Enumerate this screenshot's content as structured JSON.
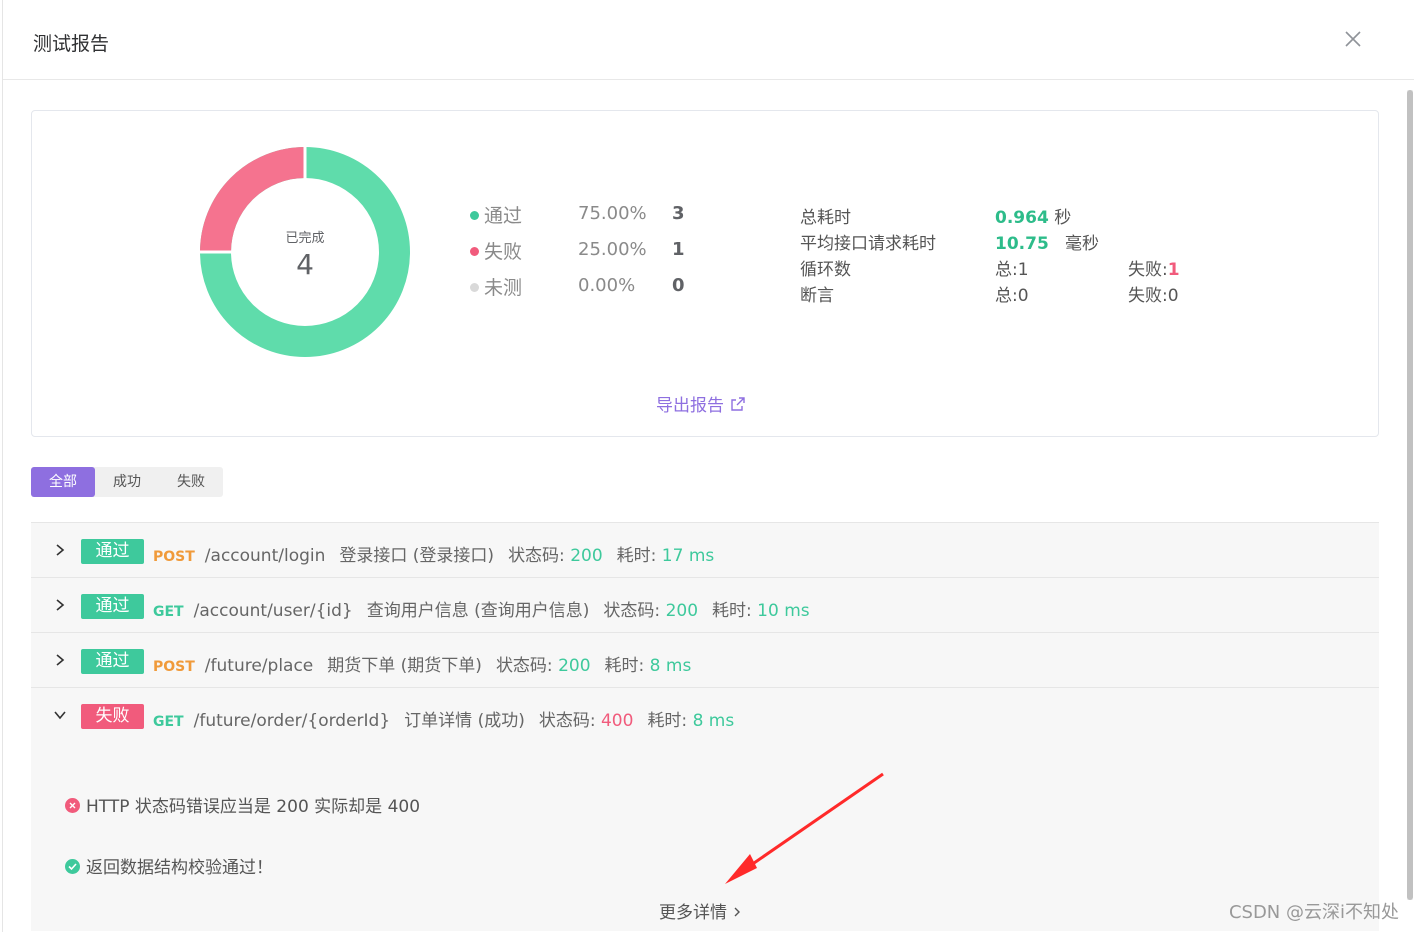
{
  "dialog": {
    "title": "测试报告"
  },
  "summary": {
    "center_label": "已完成",
    "center_value": "4",
    "legend": [
      {
        "name": "通过",
        "pct": "75.00%",
        "count": "3",
        "color": "#5fdcab"
      },
      {
        "name": "失败",
        "pct": "25.00%",
        "count": "1",
        "color": "#f5738f"
      },
      {
        "name": "未测",
        "pct": "0.00%",
        "count": "0",
        "color": "#d9d9d9"
      }
    ],
    "stats": {
      "total_time_label": "总耗时",
      "total_time_value": "0.964",
      "total_time_unit": "秒",
      "avg_time_label": "平均接口请求耗时",
      "avg_time_value": "10.75",
      "avg_time_unit": "毫秒",
      "loop_label": "循环数",
      "loop_total": "总:1",
      "loop_fail_label": "失败:",
      "loop_fail_value": "1",
      "assert_label": "断言",
      "assert_total": "总:0",
      "assert_fail": "失败:0"
    },
    "export_label": "导出报告"
  },
  "filter": {
    "tabs": [
      "全部",
      "成功",
      "失败"
    ],
    "active": 0
  },
  "results": [
    {
      "status": "通过",
      "method": "POST",
      "path": "/account/login",
      "name": "登录接口 (登录接口)",
      "code_label": "状态码:",
      "code": "200",
      "time_label": "耗时:",
      "time": "17 ms"
    },
    {
      "status": "通过",
      "method": "GET",
      "path": "/account/user/{id}",
      "name": "查询用户信息 (查询用户信息)",
      "code_label": "状态码:",
      "code": "200",
      "time_label": "耗时:",
      "time": "10 ms"
    },
    {
      "status": "通过",
      "method": "POST",
      "path": "/future/place",
      "name": "期货下单 (期货下单)",
      "code_label": "状态码:",
      "code": "200",
      "time_label": "耗时:",
      "time": "8 ms"
    },
    {
      "status": "失败",
      "method": "GET",
      "path": "/future/order/{orderId}",
      "name": "订单详情 (成功)",
      "code_label": "状态码:",
      "code": "400",
      "time_label": "耗时:",
      "time": "8 ms"
    }
  ],
  "detail": {
    "error_msg": "HTTP 状态码错误应当是 200 实际却是 400",
    "ok_msg": "返回数据结构校验通过！",
    "more_label": "更多详情"
  },
  "watermark": "CSDN @云深i不知处"
}
